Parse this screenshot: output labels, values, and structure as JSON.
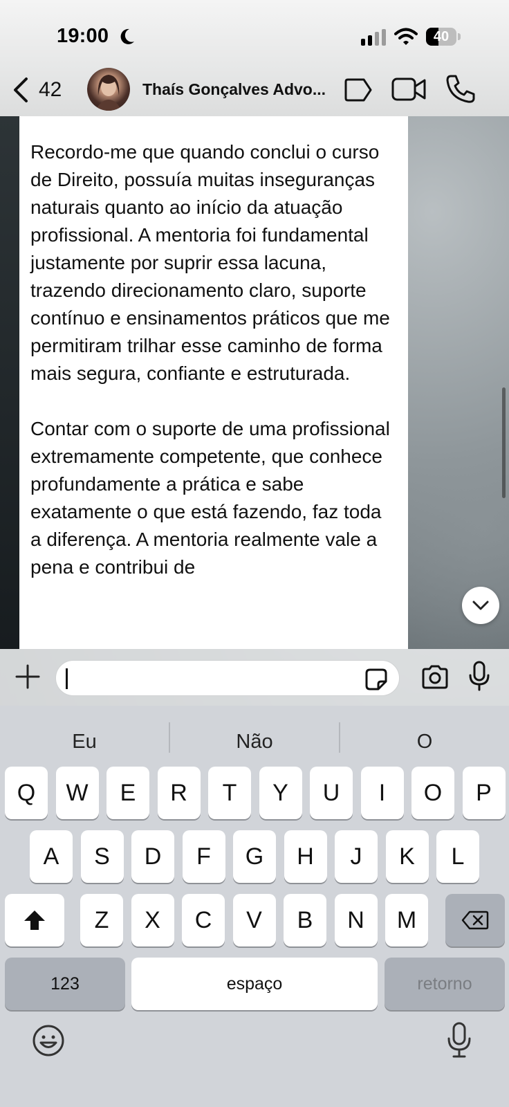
{
  "status_bar": {
    "time": "19:00",
    "battery_level": "40",
    "battery_fraction": 0.4
  },
  "header": {
    "back_count": "42",
    "contact_name": "Thaís Gonçalves Advo..."
  },
  "message": {
    "text": "Recordo-me que quando conclui o curso de Direito, possuía muitas inseguranças naturais quanto ao início da atuação profissional. A mentoria foi fundamental justamente por suprir essa lacuna, trazendo direcionamento claro, suporte contínuo e ensinamentos práticos que me permitiram trilhar esse caminho de forma mais segura, confiante e estruturada.\n\nContar com o suporte de uma profissional extremamente competente, que conhece profundamente a prática e sabe exatamente o que está fazendo, faz toda a diferença. A mentoria realmente vale a pena e contribui de"
  },
  "composer": {
    "input_value": ""
  },
  "keyboard": {
    "suggestions": [
      "Eu",
      "Não",
      "O"
    ],
    "row1": [
      "Q",
      "W",
      "E",
      "R",
      "T",
      "Y",
      "U",
      "I",
      "O",
      "P"
    ],
    "row2": [
      "A",
      "S",
      "D",
      "F",
      "G",
      "H",
      "J",
      "K",
      "L"
    ],
    "row3": [
      "Z",
      "X",
      "C",
      "V",
      "B",
      "N",
      "M"
    ],
    "numbers_label": "123",
    "space_label": "espaço",
    "return_label": "retorno"
  },
  "icons": {
    "status": [
      "moon-icon",
      "signal-icon",
      "wifi-icon",
      "battery-icon"
    ],
    "header": [
      "chevron-left-icon",
      "label-icon",
      "video-camera-icon",
      "phone-icon"
    ],
    "composer": [
      "plus-icon",
      "sticker-icon",
      "camera-icon",
      "microphone-icon"
    ],
    "keyboard": [
      "shift-icon",
      "backspace-icon",
      "emoji-icon",
      "microphone-icon"
    ]
  }
}
